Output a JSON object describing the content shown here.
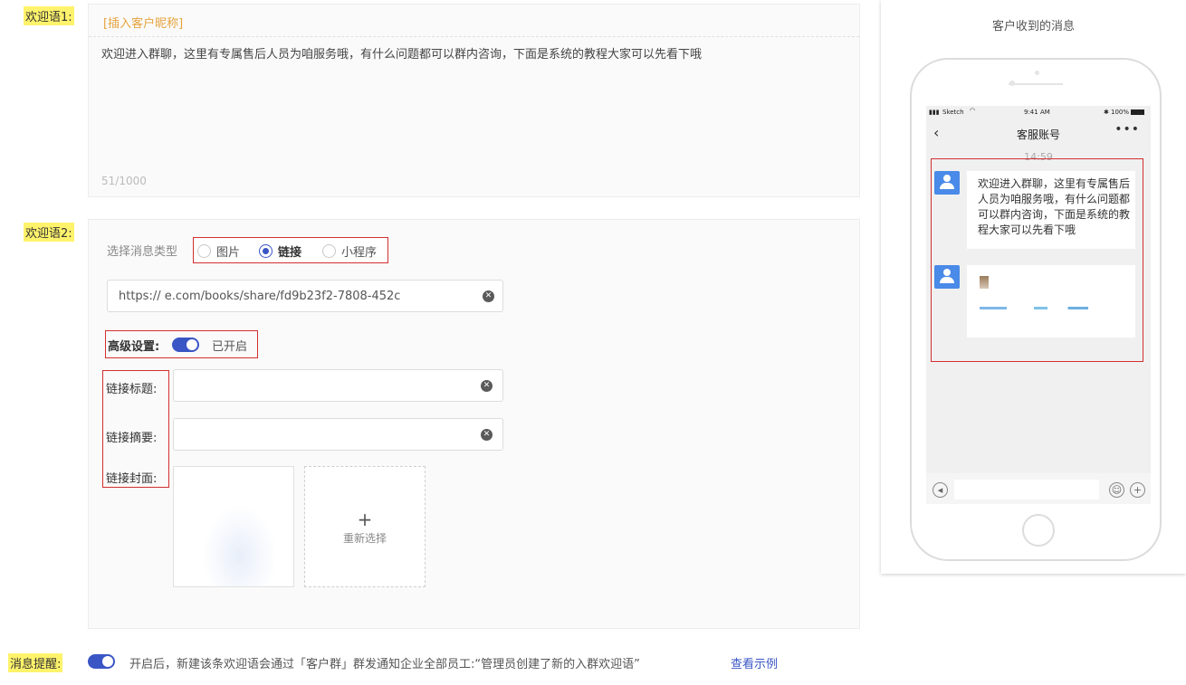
{
  "welcome1": {
    "label": "欢迎语1:",
    "insert_nickname": "[插入客户昵称]",
    "text": "欢迎进入群聊，这里有专属售后人员为咱服务哦，有什么问题都可以群内咨询，下面是系统的教程大家可以先看下哦",
    "count": "51/1000"
  },
  "welcome2": {
    "label": "欢迎语2:",
    "type_label": "选择消息类型",
    "types": [
      "图片",
      "链接",
      "小程序"
    ],
    "selected_type": "链接",
    "url": "https://              e.com/books/share/fd9b23f2-7808-452c",
    "advanced_label": "高级设置:",
    "advanced_state": "已开启",
    "advanced_enabled": true,
    "link_title_label": "链接标题:",
    "link_summary_label": "链接摘要:",
    "link_cover_label": "链接封面:",
    "reselect_label": "重新选择",
    "plus": "+"
  },
  "notify": {
    "label": "消息提醒:",
    "enabled": true,
    "description": "开启后，新建该条欢迎语会通过「客户群」群发通知企业全部员工:“管理员创建了新的入群欢迎语”",
    "example_link": "查看示例"
  },
  "preview": {
    "title": "客户收到的消息",
    "status_carrier": "Sketch",
    "status_time": "9:41 AM",
    "status_battery": "100%",
    "chat_title": "客服账号",
    "message_time": "14:59",
    "message_text": "欢迎进入群聊，这里有专属售后人员为咱服务哦，有什么问题都可以群内咨询，下面是系统的教程大家可以先看下哦"
  },
  "colors": {
    "highlight": "#fff36b",
    "accent": "#3a56c5",
    "annotation_border": "#d32f2f",
    "insert_tag": "#e6a23c",
    "avatar": "#4a8ae8"
  }
}
